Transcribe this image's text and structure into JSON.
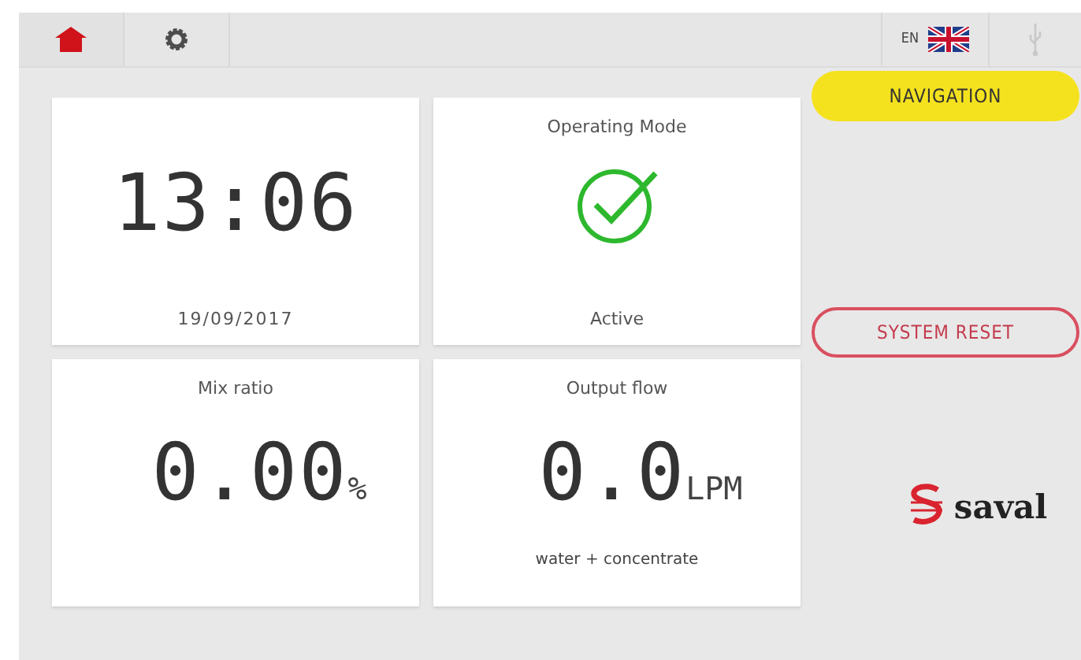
{
  "toolbar": {
    "tabs": [
      {
        "kind": "home",
        "selected": true
      },
      {
        "kind": "settings",
        "selected": false
      }
    ],
    "language": "EN"
  },
  "cards": [
    {
      "kind": "clock",
      "value": "13:06",
      "caption": "19/09/2017"
    },
    {
      "kind": "status",
      "title": "Operating Mode",
      "ok": true,
      "caption": "Active"
    },
    {
      "kind": "reading",
      "title": "Mix ratio",
      "value": "0.00",
      "unit": "%"
    },
    {
      "kind": "reading",
      "title": "Output flow",
      "value": "0.0",
      "unit": "LPM",
      "caption": "water + concentrate"
    }
  ],
  "buttons": [
    {
      "label": "NAVIGATION",
      "kind": "primary"
    },
    {
      "label": "SYSTEM RESET",
      "kind": "outline"
    }
  ],
  "logo": "saval"
}
